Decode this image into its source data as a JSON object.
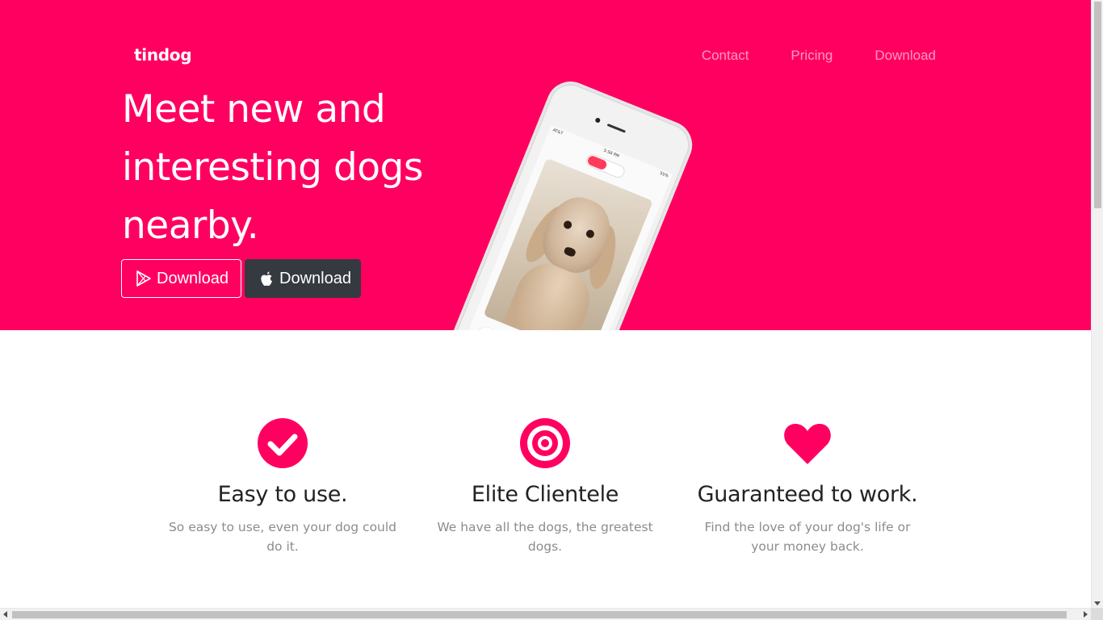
{
  "header": {
    "brand": "tindog",
    "nav": [
      "Contact",
      "Pricing",
      "Download"
    ]
  },
  "hero": {
    "headline": "Meet new and interesting dogs nearby.",
    "buttons": [
      {
        "label": "Download",
        "icon": "google-play-icon"
      },
      {
        "label": "Download",
        "icon": "apple-icon"
      }
    ],
    "phone": {
      "status_carrier": "AT&T",
      "status_time": "5:58 PM",
      "status_battery": "55%"
    }
  },
  "features": [
    {
      "title": "Easy to use.",
      "text": "So easy to use, even your dog could do it.",
      "icon": "check-circle-icon"
    },
    {
      "title": "Elite Clientele",
      "text": "We have all the dogs, the greatest dogs.",
      "icon": "bullseye-icon"
    },
    {
      "title": "Guaranteed to work.",
      "text": "Find the love of your dog's life or your money back.",
      "icon": "heart-icon"
    }
  ],
  "colors": {
    "brand": "#ff0061",
    "dark_button": "#343a40",
    "muted_text": "#8c8c8c"
  }
}
